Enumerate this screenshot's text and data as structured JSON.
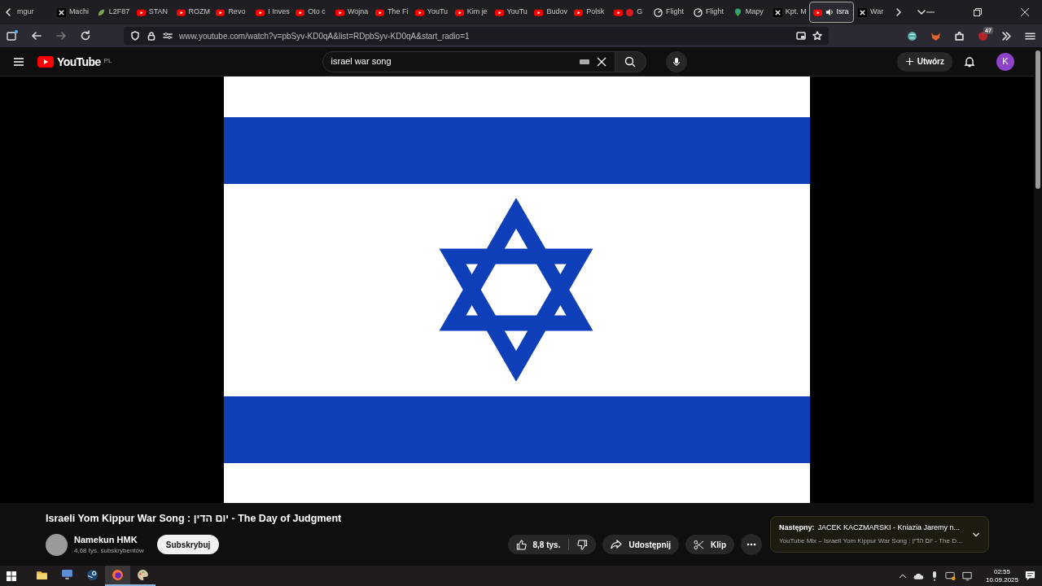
{
  "browser": {
    "tabs": [
      {
        "label": "mgur",
        "kind": "plain",
        "selected": false,
        "audio": false
      },
      {
        "label": "Machi",
        "kind": "x",
        "selected": false,
        "audio": false
      },
      {
        "label": "L2F87",
        "kind": "leaf",
        "selected": false,
        "audio": false
      },
      {
        "label": "STAN",
        "kind": "youtube",
        "selected": false,
        "audio": false
      },
      {
        "label": "ROZM",
        "kind": "youtube",
        "selected": false,
        "audio": false
      },
      {
        "label": "Revo",
        "kind": "youtube",
        "selected": false,
        "audio": false
      },
      {
        "label": "I Inves",
        "kind": "youtube",
        "selected": false,
        "audio": false
      },
      {
        "label": "Oto c",
        "kind": "youtube",
        "selected": false,
        "audio": false
      },
      {
        "label": "Wojna",
        "kind": "youtube",
        "selected": false,
        "audio": false
      },
      {
        "label": "The Fi",
        "kind": "youtube",
        "selected": false,
        "audio": false
      },
      {
        "label": "YouTu",
        "kind": "youtube",
        "selected": false,
        "audio": false
      },
      {
        "label": "Kim je",
        "kind": "youtube",
        "selected": false,
        "audio": false
      },
      {
        "label": "YouTu",
        "kind": "youtube",
        "selected": false,
        "audio": false
      },
      {
        "label": "Budov",
        "kind": "youtube",
        "selected": false,
        "audio": false
      },
      {
        "label": "Polsk",
        "kind": "youtube",
        "selected": false,
        "audio": false
      },
      {
        "label": "G",
        "kind": "live",
        "selected": false,
        "audio": false
      },
      {
        "label": "Flight",
        "kind": "radar",
        "selected": false,
        "audio": false
      },
      {
        "label": "Flight",
        "kind": "radar",
        "selected": false,
        "audio": false
      },
      {
        "label": "Mapy",
        "kind": "maps",
        "selected": false,
        "audio": false
      },
      {
        "label": "Kpt. M",
        "kind": "x",
        "selected": false,
        "audio": false
      },
      {
        "label": "Isra",
        "kind": "youtube",
        "selected": true,
        "audio": true
      },
      {
        "label": "War",
        "kind": "x",
        "selected": false,
        "audio": false
      }
    ],
    "url": "www.youtube.com/watch?v=pbSyv-KD0qA&list=RDpbSyv-KD0qA&start_radio=1",
    "extensions_badge": "47"
  },
  "youtube": {
    "logo": "YouTube",
    "region": "PL",
    "search": {
      "value": "israel war song"
    },
    "create": "Utwórz",
    "avatar": "K"
  },
  "video": {
    "title": "Israeli Yom Kippur War Song : יום הדין - The Day of Judgment",
    "channel": {
      "name": "Namekun HMK",
      "subscribers": "4,68 tys. subskrybentów"
    },
    "subscribe": "Subskrybuj",
    "likes": "8,8 tys.",
    "share": "Udostępnij",
    "clip": "Klip",
    "next": {
      "label": "Następny:",
      "title": "JACEK KACZMARSKI - Kniazia Jaremy n...",
      "playlist": "YouTube Mix – Israeli Yom Kippur War Song : יום הדין - The D..."
    }
  },
  "taskbar": {
    "apps": [
      {
        "kind": "folder",
        "selected": false,
        "running": false
      },
      {
        "kind": "computer",
        "selected": false,
        "running": false
      },
      {
        "kind": "steam",
        "selected": false,
        "running": false
      },
      {
        "kind": "firefox",
        "selected": true,
        "running": true
      },
      {
        "kind": "paint",
        "selected": false,
        "running": true
      }
    ],
    "time": "02:55",
    "date": "10.09.2025"
  }
}
